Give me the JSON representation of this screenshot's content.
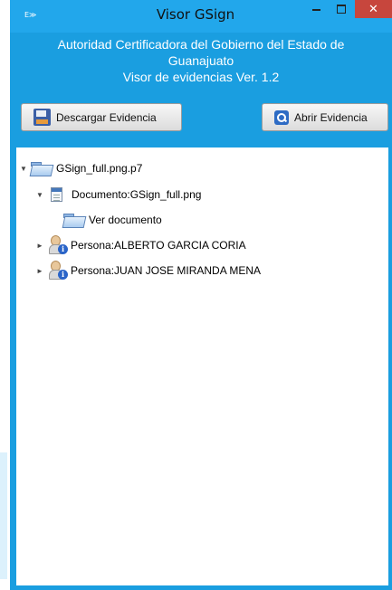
{
  "window": {
    "title": "Visor GSign",
    "app_icon_text": "E≫",
    "close_glyph": "✕"
  },
  "header": {
    "line1": "Autoridad Certificadora del Gobierno del Estado de",
    "line2": "Guanajuato",
    "line3": "Visor de evidencias Ver. 1.2"
  },
  "toolbar": {
    "download_label": "Descargar Evidencia",
    "download_icon": "floppy-disk-icon",
    "open_label": "Abrir Evidencia",
    "open_icon": "search-icon"
  },
  "tree": {
    "root": {
      "label": "GSign_full.png.p7",
      "expanded": true,
      "icon": "folder-open-icon"
    },
    "document": {
      "label": "Documento:GSign_full.png",
      "expanded": true,
      "icon": "document-icon"
    },
    "view_document": {
      "label": "Ver documento",
      "icon": "folder-open-icon"
    },
    "persons": [
      {
        "label": "Persona:ALBERTO GARCIA CORIA",
        "expanded": false,
        "icon": "person-info-icon"
      },
      {
        "label": "Persona:JUAN JOSE MIRANDA MENA",
        "expanded": false,
        "icon": "person-info-icon"
      }
    ],
    "expanded_glyph": "▼",
    "collapsed_glyph": "►"
  },
  "colors": {
    "accent": "#1a9ee0",
    "close_button": "#c7463d"
  }
}
